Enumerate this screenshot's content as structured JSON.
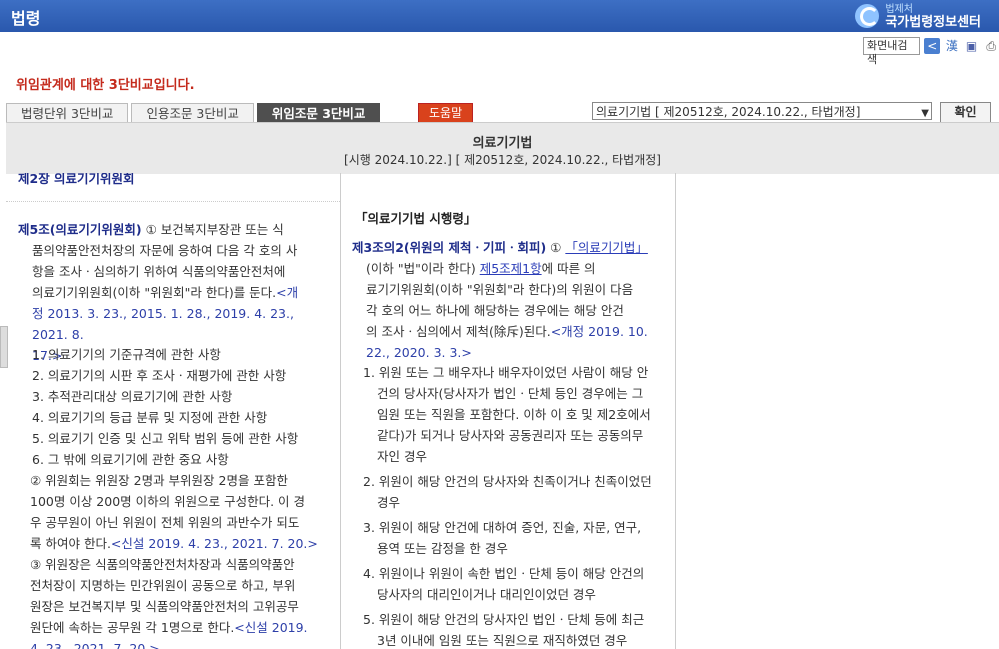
{
  "app": {
    "title": "법령",
    "logo_small": "법제처",
    "logo_big": "국가법령정보센터"
  },
  "tools": {
    "search_label": "화면내검색",
    "hanja_label": "漢"
  },
  "notice": "위임관계에 대한 3단비교입니다.",
  "tabs": [
    {
      "label": "법령단위 3단비교",
      "active": false
    },
    {
      "label": "인용조문 3단비교",
      "active": false
    },
    {
      "label": "위임조문 3단비교",
      "active": true
    }
  ],
  "help_label": "도움말",
  "select": {
    "value": "의료기기법 [ 제20512호, 2024.10.22., 타법개정]"
  },
  "confirm_label": "확인",
  "header": {
    "law_name": "의료기기법",
    "info": "[시행 2024.10.22.] [ 제20512호, 2024.10.22., 타법개정]"
  },
  "col1": {
    "cut_heading": "제2장 의료기기위원회",
    "art5_title": "제5조(의료기기위원회)",
    "art5_p1_lines": [
      "① 보건복지부장관 또는 식",
      "품의약품안전처장의 자문에 응하여 다음 각 호의 사",
      "항을 조사ㆍ심의하기 위하여 식품의약품안전처에",
      "의료기기위원회(이하 \"위원회\"라 한다)를 둔다."
    ],
    "art5_p1_amend_lines": [
      "<개",
      "정 2013. 3. 23., 2015. 1. 28., 2019. 4. 23., 2021. 8.",
      "17.>"
    ],
    "items": [
      "1. 의료기기의 기준규격에 관한 사항",
      "2. 의료기기의 시판 후 조사ㆍ재평가에 관한 사항",
      "3. 추적관리대상 의료기기에 관한 사항",
      "4. 의료기기의 등급 분류 및 지정에 관한 사항",
      "5. 의료기기 인증 및 신고 위탁 범위 등에 관한 사항",
      "6. 그 밖에 의료기기에 관한 중요 사항"
    ],
    "p2_lines": [
      "② 위원회는 위원장 2명과 부위원장 2명을 포함한",
      "100명 이상 200명 이하의 위원으로 구성한다. 이 경",
      "우 공무원이 아닌 위원이 전체 위원의 과반수가 되도",
      "록 하여야 한다."
    ],
    "p2_amend": "<신설 2019. 4. 23., 2021. 7. 20.>",
    "p3_lines": [
      "③ 위원장은 식품의약품안전처차장과 식품의약품안",
      "전처장이 지명하는 민간위원이 공동으로 하고, 부위",
      "원장은 보건복지부 및 식품의약품안전처의 고위공무",
      "원단에 속하는 공무원 각 1명으로 한다."
    ],
    "p3_amend_lines": [
      "<신설 2019.",
      "4. 23., 2021. 7. 20.>"
    ]
  },
  "col2": {
    "decree_title": "「의료기기법 시행령」",
    "art_title": "제3조의2(위원의 제척ㆍ기피ㆍ회피)",
    "link_law": "「의료기기법」",
    "link_art": "제5조",
    "link_para": "제1항",
    "lines": [
      "① ",
      "(이하 \"법\"이라 한다) ",
      "에 따른 의",
      "료기기위원회(이하 \"위원회\"라 한다)의 위원이 다음",
      "각 호의 어느 하나에 해당하는 경우에는 해당 안건",
      "의 조사ㆍ심의에서 제척(除斥)된다."
    ],
    "amend_lines": [
      "<개정 2019. 10.",
      "22., 2020. 3. 3.>"
    ],
    "items": [
      "1. 위원 또는 그 배우자나 배우자이었던 사람이 해당 안건의 당사자(당사자가 법인ㆍ단체 등인 경우에는 그 임원 또는 직원을 포함한다. 이하 이 호 및 제2호에서 같다)가 되거나 당사자와 공동권리자 또는 공동의무자인 경우",
      "2. 위원이 해당 안건의 당사자와 친족이거나 친족이었던 경우",
      "3. 위원이 해당 안건에 대하여 증언, 진술, 자문, 연구, 용역 또는 감정을 한 경우",
      "4. 위원이나 위원이 속한 법인ㆍ단체 등이 해당 안건의 당사자의 대리인이거나 대리인이었던 경우",
      "5. 위원이 해당 안건의 당사자인 법인ㆍ단체 등에 최근 3년 이내에 임원 또는 직원으로 재직하였던 경우"
    ]
  }
}
